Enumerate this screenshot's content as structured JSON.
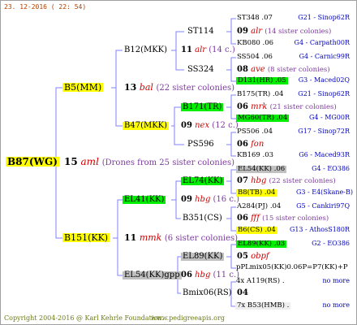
{
  "header": {
    "date": "23. 12-2016 ( 22: 54)"
  },
  "footer": {
    "copyright": "Copyright 2004-2016 @ Karl Kehrle Foundation.",
    "url": "www.pedigreeapis.org"
  },
  "colors": {
    "yellow": "#ffff00",
    "green": "#00ee00",
    "grey": "#c0c0c0",
    "link_blue": "#0000c0",
    "sister_purple": "#7c3a9e",
    "name_red": "#d00000",
    "line_blue": "#8080ff"
  },
  "root": {
    "name": "B87(WG)",
    "gen": "15",
    "abbr": "aml",
    "note": "(Drones from 25 sister colonies)",
    "p1": {
      "name": "B5(MM)",
      "gen": "13",
      "abbr": "bal",
      "note": "(22 sister colonies)",
      "a": {
        "name": "B12(MKK)",
        "gen": "11",
        "abbr": "alr",
        "note": "(14 c.)",
        "a": {
          "name": "ST114",
          "gen": "09",
          "abbr": "alr",
          "note": "(14 sister colonies)",
          "l1": {
            "name": "ST348 .07",
            "ref": "G21 - Sinop62R"
          },
          "l2": {
            "name": "KB080 .06",
            "ref": "G4 - Carpath00R"
          }
        },
        "b": {
          "name": "SS324",
          "gen": "08",
          "abbr": "ave",
          "note": "(8 sister colonies)",
          "l1": {
            "name": "SS504 .06",
            "ref": "G4 - Carnic99R"
          },
          "l2": {
            "name": "D131(HR) .05",
            "ref": "G3 - Maced02Q"
          }
        }
      },
      "b": {
        "name": "B47(MKK)",
        "gen": "09",
        "abbr": "nex",
        "note": "(12 c.)",
        "a": {
          "name": "B171(TR)",
          "gen": "06",
          "abbr": "mrk",
          "note": "(21 sister colonies)",
          "l1": {
            "name": "B175(TR) .04",
            "ref": "G21 - Sinop62R"
          },
          "l2": {
            "name": "MG60(TR) .04",
            "ref": "G4 - MG00R"
          }
        },
        "b": {
          "name": "PS596",
          "gen": "06",
          "abbr": "fon",
          "note": "",
          "l1": {
            "name": "PS506 .04",
            "ref": "G17 - Sinop72R"
          },
          "l2": {
            "name": "KB169 .03",
            "ref": "G6 - Maced93R"
          }
        }
      }
    },
    "p2": {
      "name": "B151(KK)",
      "gen": "11",
      "abbr": "mmk",
      "note": "(6 sister colonies)",
      "a": {
        "name": "EL41(KK)",
        "gen": "09",
        "abbr": "hbg",
        "note": "(16 c.)",
        "a": {
          "name": "EL74(KK)",
          "gen": "07",
          "abbr": "hbg",
          "note": "(22 sister colonies)",
          "l1": {
            "name": "EL54(KK) .06",
            "ref": "G4 - EO386"
          },
          "l2": {
            "name": "B8(TB) .04",
            "ref": "G3 - E4(Skane-B)"
          }
        },
        "b": {
          "name": "B351(CS)",
          "gen": "06",
          "abbr": "fff",
          "note": "(15 sister colonies)",
          "l1": {
            "name": "A284(PJ) .04",
            "ref": "G5 - Cankiri97Q"
          },
          "l2": {
            "name": "B6(CS) .04",
            "ref": "G13 - AthosS180R"
          }
        }
      },
      "b": {
        "name": "EL54(KK)gpp",
        "gen": "06",
        "abbr": "hbg",
        "note": "(11 c.)",
        "a": {
          "name": "EL89(KK)",
          "gen": "05",
          "abbr": "obpf",
          "note": "",
          "l1": {
            "name": "EL89(KK) .03",
            "ref": "G2 - EO386"
          },
          "l2": {
            "name": "pPLmix05(KK)0.06P=P7(KK)+P",
            "ref": ""
          }
        },
        "b": {
          "name": "Bmix06(RS)",
          "gen": "04",
          "abbr": "",
          "note": "",
          "l1": {
            "name": "4x A119(RS) .",
            "ref": "no more"
          },
          "l2": {
            "name": "7x B53(HMB) .",
            "ref": "no more"
          }
        }
      }
    }
  }
}
